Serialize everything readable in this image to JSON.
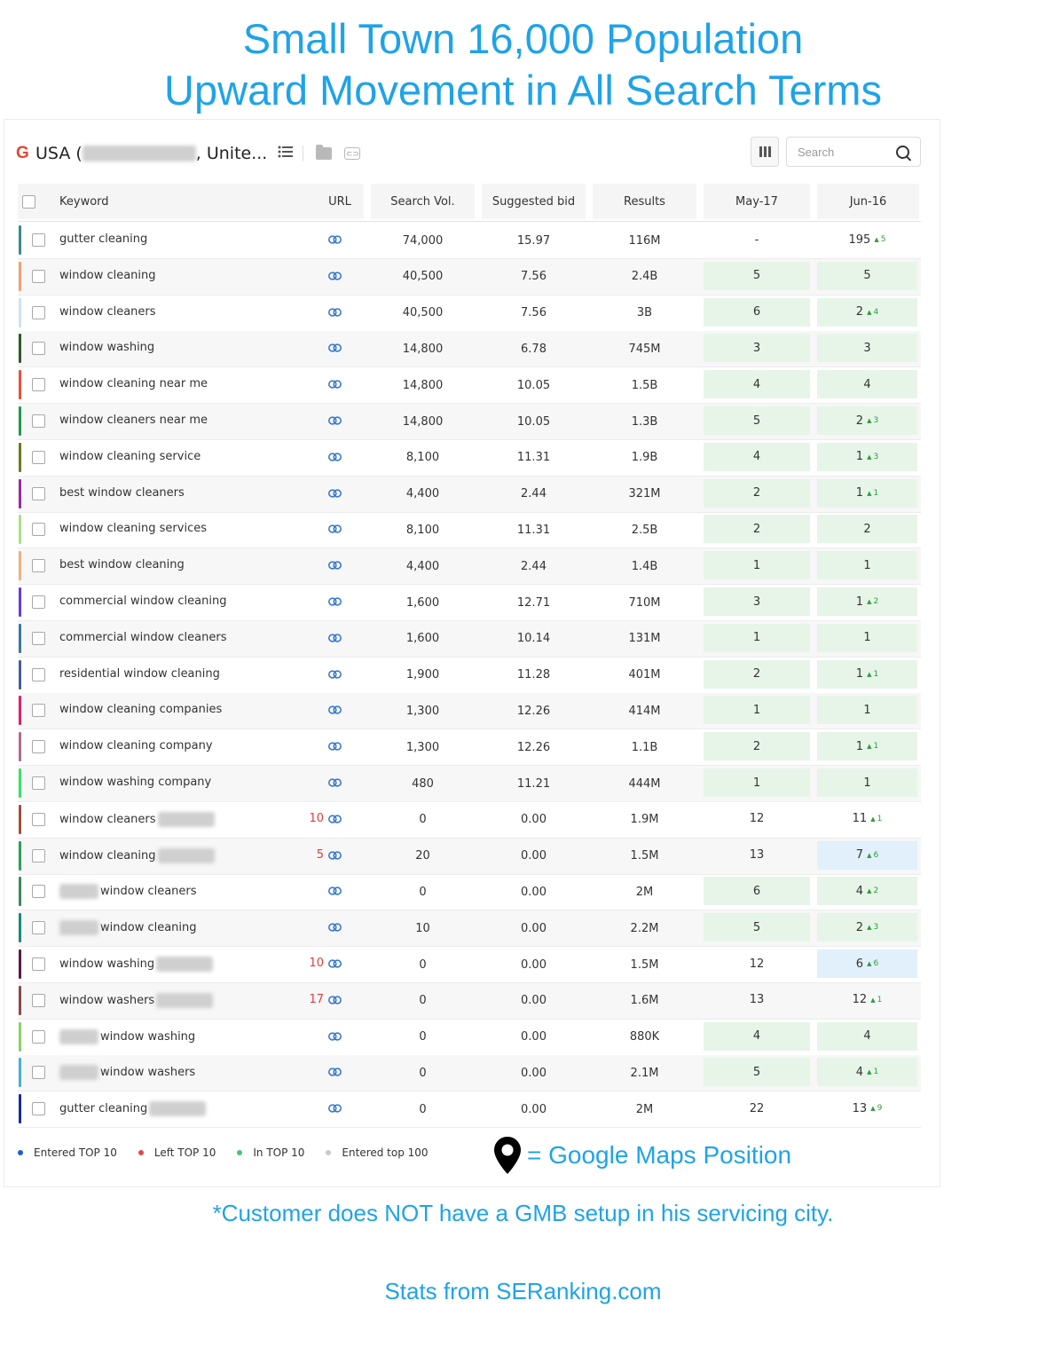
{
  "headline": {
    "line1": "Small Town 16,000 Population",
    "line2": "Upward Movement in All Search Terms"
  },
  "toolbar": {
    "engine_icon": "G",
    "region_prefix": "USA (",
    "region_suffix": ", Unite...",
    "search_placeholder": "Search"
  },
  "table": {
    "headers": [
      "Keyword",
      "URL",
      "Search Vol.",
      "Suggested bid",
      "Results",
      "May-17",
      "Jun-16"
    ],
    "rows": [
      {
        "keyword": "gutter cleaning",
        "stripe": "#3a8a8a",
        "vol": "74,000",
        "bid": "15.97",
        "results": "116M",
        "may": "-",
        "jun": "195",
        "change": "5",
        "may_hl": "",
        "jun_hl": ""
      },
      {
        "keyword": "window cleaning",
        "stripe": "#f0a070",
        "vol": "40,500",
        "bid": "7.56",
        "results": "2.4B",
        "may": "5",
        "jun": "5",
        "change": "",
        "may_hl": "green",
        "jun_hl": "green"
      },
      {
        "keyword": "window cleaners",
        "stripe": "#cfe3ea",
        "vol": "40,500",
        "bid": "7.56",
        "results": "3B",
        "may": "6",
        "jun": "2",
        "change": "4",
        "may_hl": "green",
        "jun_hl": "green"
      },
      {
        "keyword": "window washing",
        "stripe": "#2f5a2a",
        "vol": "14,800",
        "bid": "6.78",
        "results": "745M",
        "may": "3",
        "jun": "3",
        "change": "",
        "may_hl": "green",
        "jun_hl": "green"
      },
      {
        "keyword": "window cleaning near me",
        "stripe": "#e8503a",
        "vol": "14,800",
        "bid": "10.05",
        "results": "1.5B",
        "may": "4",
        "jun": "4",
        "change": "",
        "may_hl": "green",
        "jun_hl": "green"
      },
      {
        "keyword": "window cleaners near me",
        "stripe": "#1f9a4a",
        "vol": "14,800",
        "bid": "10.05",
        "results": "1.3B",
        "may": "5",
        "jun": "2",
        "change": "3",
        "may_hl": "green",
        "jun_hl": "green"
      },
      {
        "keyword": "window cleaning service",
        "stripe": "#6a7a20",
        "vol": "8,100",
        "bid": "11.31",
        "results": "1.9B",
        "may": "4",
        "jun": "1",
        "change": "3",
        "may_hl": "green",
        "jun_hl": "green"
      },
      {
        "keyword": "best window cleaners",
        "stripe": "#9a2aa0",
        "vol": "4,400",
        "bid": "2.44",
        "results": "321M",
        "may": "2",
        "jun": "1",
        "change": "1",
        "may_hl": "green",
        "jun_hl": "green"
      },
      {
        "keyword": "window cleaning services",
        "stripe": "#a8e08a",
        "vol": "8,100",
        "bid": "11.31",
        "results": "2.5B",
        "may": "2",
        "jun": "2",
        "change": "",
        "may_hl": "green",
        "jun_hl": "green"
      },
      {
        "keyword": "best window cleaning",
        "stripe": "#f0b080",
        "vol": "4,400",
        "bid": "2.44",
        "results": "1.4B",
        "may": "1",
        "jun": "1",
        "change": "",
        "may_hl": "green",
        "jun_hl": "green"
      },
      {
        "keyword": "commercial window cleaning",
        "stripe": "#6a3ae0",
        "vol": "1,600",
        "bid": "12.71",
        "results": "710M",
        "may": "3",
        "jun": "1",
        "change": "2",
        "may_hl": "green",
        "jun_hl": "green"
      },
      {
        "keyword": "commercial window cleaners",
        "stripe": "#3a7aa0",
        "vol": "1,600",
        "bid": "10.14",
        "results": "131M",
        "may": "1",
        "jun": "1",
        "change": "",
        "may_hl": "green",
        "jun_hl": "green"
      },
      {
        "keyword": "residential window cleaning",
        "stripe": "#4a5aa0",
        "vol": "1,900",
        "bid": "11.28",
        "results": "401M",
        "may": "2",
        "jun": "1",
        "change": "1",
        "may_hl": "green",
        "jun_hl": "green"
      },
      {
        "keyword": "window cleaning companies",
        "stripe": "#e0206a",
        "vol": "1,300",
        "bid": "12.26",
        "results": "414M",
        "may": "1",
        "jun": "1",
        "change": "",
        "may_hl": "green",
        "jun_hl": "green"
      },
      {
        "keyword": "window cleaning company",
        "stripe": "#b06a8a",
        "vol": "1,300",
        "bid": "12.26",
        "results": "1.1B",
        "may": "2",
        "jun": "1",
        "change": "1",
        "may_hl": "green",
        "jun_hl": "green"
      },
      {
        "keyword": "window washing company",
        "stripe": "#3ae06a",
        "vol": "480",
        "bid": "11.21",
        "results": "444M",
        "may": "1",
        "jun": "1",
        "change": "",
        "may_hl": "green",
        "jun_hl": "green"
      },
      {
        "keyword": "window cleaners",
        "blur": "post",
        "map": "10",
        "stripe": "#a0503a",
        "vol": "0",
        "bid": "0.00",
        "results": "1.9M",
        "may": "12",
        "jun": "11",
        "change": "1",
        "may_hl": "",
        "jun_hl": ""
      },
      {
        "keyword": "window cleaning",
        "blur": "post",
        "map": "5",
        "stripe": "#2aa05a",
        "vol": "20",
        "bid": "0.00",
        "results": "1.5M",
        "may": "13",
        "jun": "7",
        "change": "6",
        "may_hl": "",
        "jun_hl": "blue"
      },
      {
        "keyword": "window cleaners",
        "blur": "pre",
        "stripe": "#3a8a5a",
        "vol": "0",
        "bid": "0.00",
        "results": "2M",
        "may": "6",
        "jun": "4",
        "change": "2",
        "may_hl": "green",
        "jun_hl": "green"
      },
      {
        "keyword": "window cleaning",
        "blur": "pre",
        "stripe": "#1a8a7a",
        "vol": "10",
        "bid": "0.00",
        "results": "2.2M",
        "may": "5",
        "jun": "2",
        "change": "3",
        "may_hl": "green",
        "jun_hl": "green"
      },
      {
        "keyword": "window washing",
        "blur": "post",
        "map": "10",
        "stripe": "#5a1a4a",
        "vol": "0",
        "bid": "0.00",
        "results": "1.5M",
        "may": "12",
        "jun": "6",
        "change": "6",
        "may_hl": "",
        "jun_hl": "blue"
      },
      {
        "keyword": "window washers",
        "blur": "post",
        "map": "17",
        "stripe": "#8a4a4a",
        "vol": "0",
        "bid": "0.00",
        "results": "1.6M",
        "may": "13",
        "jun": "12",
        "change": "1",
        "may_hl": "",
        "jun_hl": ""
      },
      {
        "keyword": "window washing",
        "blur": "pre",
        "stripe": "#8ad06a",
        "vol": "0",
        "bid": "0.00",
        "results": "880K",
        "may": "4",
        "jun": "4",
        "change": "",
        "may_hl": "green",
        "jun_hl": "green"
      },
      {
        "keyword": "window washers",
        "blur": "pre",
        "stripe": "#4ab0d0",
        "vol": "0",
        "bid": "0.00",
        "results": "2.1M",
        "may": "5",
        "jun": "4",
        "change": "1",
        "may_hl": "green",
        "jun_hl": "green"
      },
      {
        "keyword": "gutter cleaning",
        "blur": "post",
        "stripe": "#1a2aa0",
        "vol": "0",
        "bid": "0.00",
        "results": "2M",
        "may": "22",
        "jun": "13",
        "change": "9",
        "may_hl": "",
        "jun_hl": ""
      }
    ]
  },
  "legend": {
    "items": [
      {
        "label": "Entered TOP 10",
        "color": "#1a5fcf"
      },
      {
        "label": "Left TOP 10",
        "color": "#e04a4a"
      },
      {
        "label": "In TOP 10",
        "color": "#4ac07a"
      },
      {
        "label": "Entered top 100",
        "color": "#c8c8c8"
      }
    ]
  },
  "maps_note": "= Google Maps Position",
  "note1": "*Customer does NOT have a GMB setup in his servicing city.",
  "note2": "Stats from SERanking.com",
  "colors": {
    "accent": "#1fa3e8",
    "up_arrow": "#2e9d3b",
    "map_number": "#e03b3b"
  }
}
